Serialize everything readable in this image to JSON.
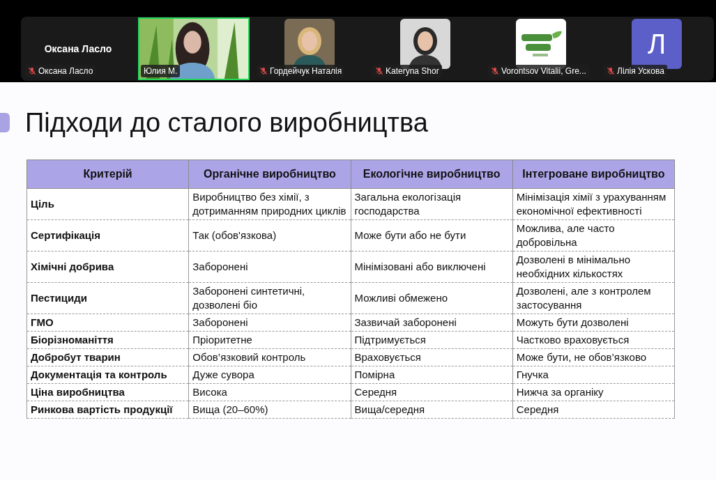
{
  "participants": [
    {
      "kind": "name",
      "name": "Оксана Ласло",
      "label": "Оксана Ласло",
      "muted": true,
      "selected": false
    },
    {
      "kind": "video",
      "label": "Юлия М.",
      "muted": false,
      "selected": true
    },
    {
      "label": "Гордейчук Наталія",
      "muted": true,
      "selected": false
    },
    {
      "label": "Kateryna Shor",
      "muted": true,
      "selected": false
    },
    {
      "label": "Vorontsov Vitalii, Gre...",
      "muted": true,
      "selected": false
    },
    {
      "kind": "letter",
      "letter": "Л",
      "label": "Лілія Ускова",
      "muted": true,
      "selected": false
    }
  ],
  "slide": {
    "title": "Підходи до сталого виробництва",
    "table": {
      "columns": [
        "Критерій",
        "Органічне виробництво",
        "Екологічне виробництво",
        "Інтегроване виробництво"
      ],
      "rows": [
        [
          "Ціль",
          "Виробництво без хімії, з дотриманням природних циклів",
          "Загальна екологізація господарства",
          "Мінімізація хімії з урахуванням економічної ефективності"
        ],
        [
          "Сертифікація",
          "Так (обов'язкова)",
          "Може бути або не бути",
          "Можлива, але часто добровільна"
        ],
        [
          "Хімічні добрива",
          "Заборонені",
          "Мінімізовані або виключені",
          "Дозволені в мінімально необхідних кількостях"
        ],
        [
          "Пестициди",
          "Заборонені синтетичні, дозволені біо",
          "Можливі обмежено",
          "Дозволені, але з контролем застосування"
        ],
        [
          "ГМО",
          "Заборонені",
          "Зазвичай заборонені",
          "Можуть бути дозволені"
        ],
        [
          "Біорізноманіття",
          "Пріоритетне",
          "Підтримується",
          "Частково враховується"
        ],
        [
          "Добробут тварин",
          "Обов’язковий контроль",
          "Враховується",
          "Може бути, не обов’язково"
        ],
        [
          "Документація та контроль",
          "Дуже сувора",
          "Помірна",
          "Гнучка"
        ],
        [
          "Ціна виробництва",
          "Висока",
          "Середня",
          "Нижча за органіку"
        ],
        [
          "Ринкова вартість продукції",
          "Вища (20–60%)",
          "Вища/середня",
          "Середня"
        ]
      ]
    }
  }
}
